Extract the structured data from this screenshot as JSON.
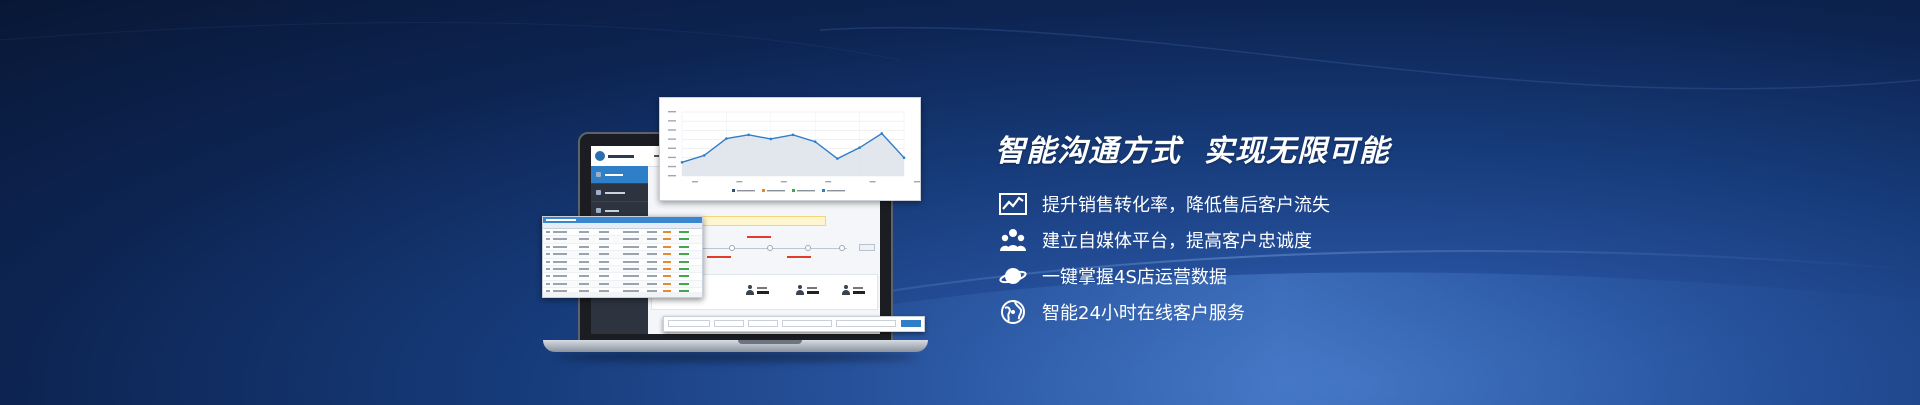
{
  "headline": "智能沟通方式  实现无限可能",
  "features": [
    {
      "icon": "trend-chart-icon",
      "text": "提升销售转化率，降低售后客户流失"
    },
    {
      "icon": "user-group-icon",
      "text": "建立自媒体平台，提高客户忠诚度"
    },
    {
      "icon": "planet-icon",
      "text": "一键掌握4S店运营数据"
    },
    {
      "icon": "globe-service-icon",
      "text": "智能24小时在线客户服务"
    }
  ],
  "colors": {
    "background_dark": "#081735",
    "background_light": "#3d6fc0",
    "chart_line": "#2f7ec8",
    "accent_blue": "#2f7ec8"
  },
  "chart_data": {
    "type": "area",
    "series": [
      {
        "values": [
          3,
          4.5,
          8.2,
          9,
          8.1,
          9,
          7.5,
          3.8,
          6.2,
          9.3,
          4
        ]
      }
    ],
    "ylim": [
      0,
      14
    ],
    "grid": true
  }
}
